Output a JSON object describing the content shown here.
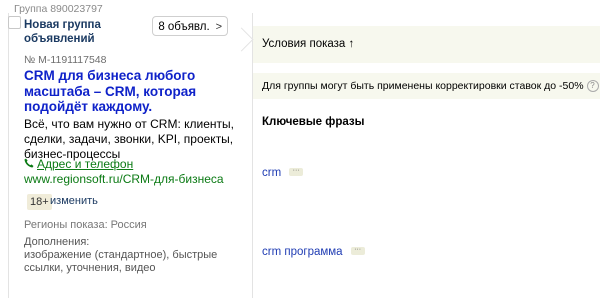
{
  "group": {
    "number": "Группа 890023797",
    "name": "Новая группа объявлений",
    "ads_button": "8 объявл."
  },
  "ad": {
    "id": "№ М-1191117548",
    "title": "CRM для бизнеса любого масштаба – CRM, которая подойдёт каждому.",
    "text": "Всё, что вам нужно от CRM: клиенты, сделки, задачи, звонки, KPI, проекты, бизнес-процессы",
    "contacts": "Адрес и телефон",
    "url": "www.regionsoft.ru/CRM-для-бизнеса",
    "age": "18+",
    "age_change": "изменить",
    "regions": "Регионы показа: Россия",
    "extras_label": "Дополнения:",
    "extras_text": "изображение (стандартное), быстрые ссылки, уточнения, видео"
  },
  "conditions": {
    "title": "Условия показа ↑",
    "notice": "Для группы могут быть применены корректировки ставок до -50%",
    "info_icon": "?"
  },
  "keywords": {
    "header": "Ключевые фразы",
    "items": [
      {
        "phrase": "crm",
        "more": "···"
      },
      {
        "phrase": "crm программа",
        "more": "···"
      }
    ]
  },
  "colors": {
    "ad_title": "#0f22c9",
    "green_link": "#0b7a14",
    "band": "#f7f8ee"
  }
}
